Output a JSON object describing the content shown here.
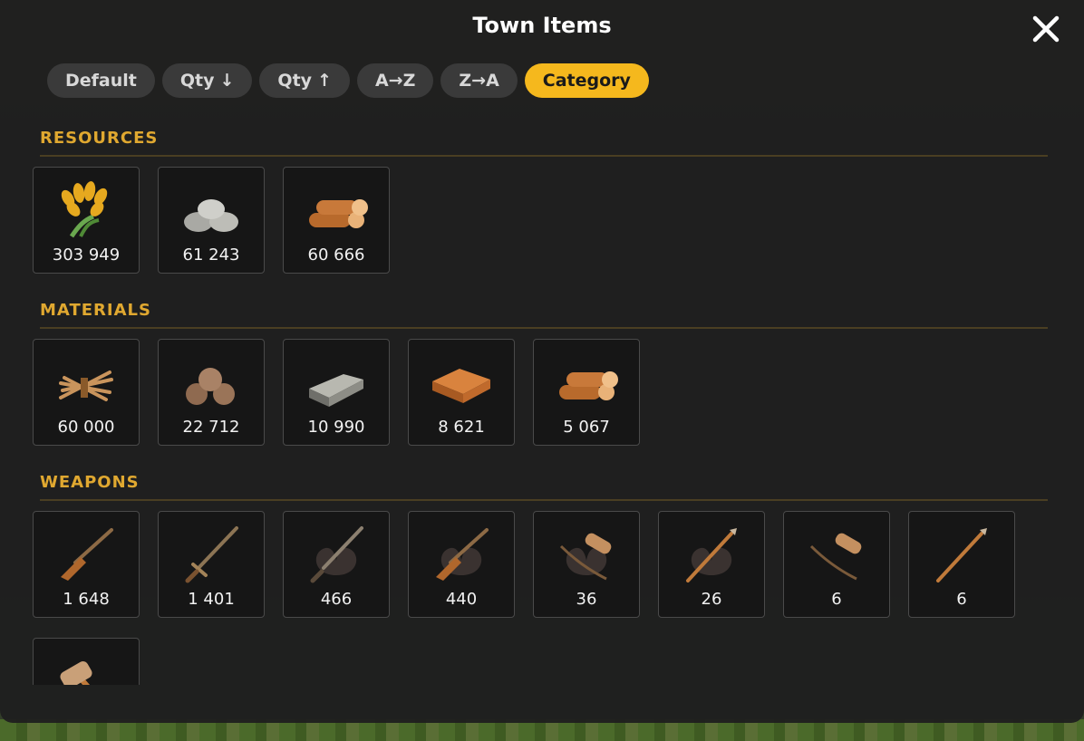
{
  "window": {
    "title": "Town Items"
  },
  "sort_options": [
    {
      "label": "Default",
      "arrow": ""
    },
    {
      "label": "Qty",
      "arrow": "↓"
    },
    {
      "label": "Qty",
      "arrow": "↑"
    },
    {
      "label": "A→Z",
      "arrow": ""
    },
    {
      "label": "Z→A",
      "arrow": ""
    },
    {
      "label": "Category",
      "arrow": ""
    }
  ],
  "active_sort": "Category",
  "sections": {
    "resources": {
      "title": "RESOURCES",
      "items": [
        {
          "icon": "wheat-icon",
          "qty": "303 949"
        },
        {
          "icon": "stone-icon",
          "qty": "61 243"
        },
        {
          "icon": "wood-logs-icon",
          "qty": "60 666"
        }
      ]
    },
    "materials": {
      "title": "MATERIALS",
      "items": [
        {
          "icon": "stick-bundle-icon",
          "qty": "60 000"
        },
        {
          "icon": "ore-pile-icon",
          "qty": "22 712"
        },
        {
          "icon": "iron-ingot-icon",
          "qty": "10 990"
        },
        {
          "icon": "planks-icon",
          "qty": "8 621"
        },
        {
          "icon": "cut-logs-icon",
          "qty": "5 067"
        }
      ]
    },
    "weapons": {
      "title": "WEAPONS",
      "items": [
        {
          "icon": "musket-icon",
          "qty": "1 648"
        },
        {
          "icon": "sword-icon",
          "qty": "1 401"
        },
        {
          "icon": "sword-icon",
          "qty": "466"
        },
        {
          "icon": "musket-icon",
          "qty": "440"
        },
        {
          "icon": "bow-quiver-icon",
          "qty": "36"
        },
        {
          "icon": "spear-icon",
          "qty": "26"
        },
        {
          "icon": "bow-quiver-icon",
          "qty": "6"
        },
        {
          "icon": "spear-icon",
          "qty": "6"
        },
        {
          "icon": "hammer-icon",
          "qty": ""
        }
      ]
    }
  },
  "colors": {
    "accent": "#f5b81d",
    "section_title": "#e0a830",
    "panel": "#1f1f1f"
  }
}
